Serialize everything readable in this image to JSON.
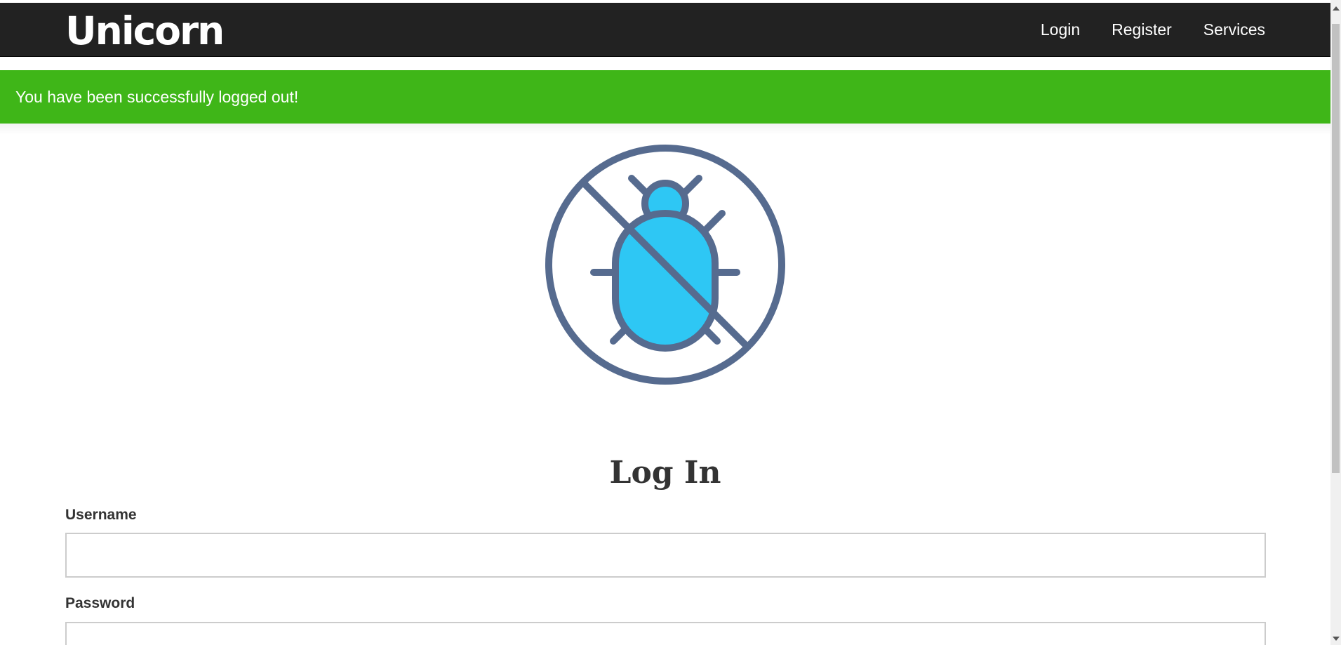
{
  "navbar": {
    "brand": "Unicorn",
    "links": [
      "Login",
      "Register",
      "Services"
    ]
  },
  "alert": {
    "message": "You have been successfully logged out!",
    "color": "#3fb618"
  },
  "logo": {
    "icon": "no-bugs-icon",
    "ring_color": "#566b8f",
    "bug_color": "#2ec7f4"
  },
  "form": {
    "title": "Log In",
    "username_label": "Username",
    "username_value": "",
    "password_label": "Password",
    "password_value": ""
  }
}
